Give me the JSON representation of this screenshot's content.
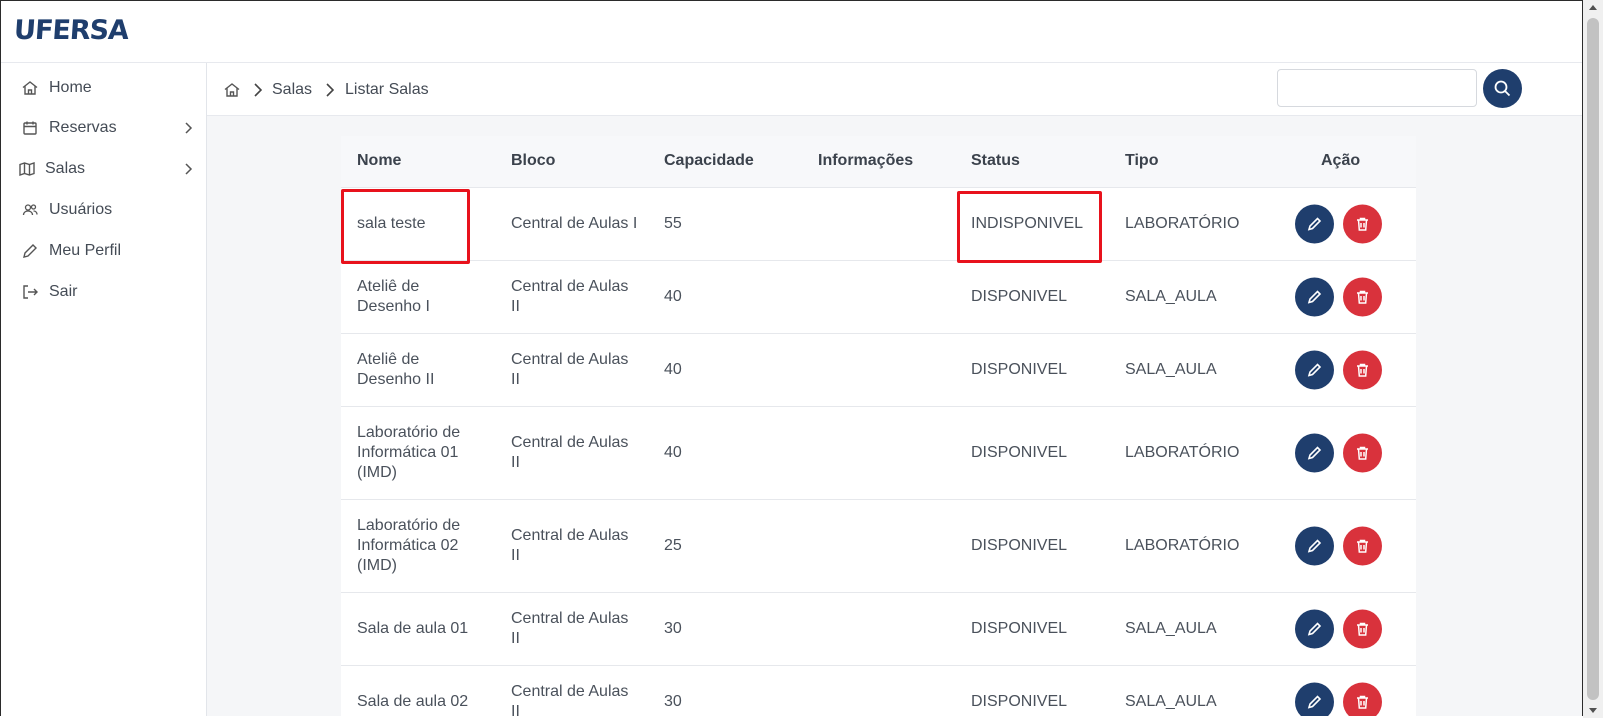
{
  "app": {
    "logo": "UFERSA"
  },
  "sidebar": {
    "items": [
      {
        "label": "Home",
        "icon": "home-icon",
        "has_submenu": false
      },
      {
        "label": "Reservas",
        "icon": "calendar-icon",
        "has_submenu": true
      },
      {
        "label": "Salas",
        "icon": "map-icon",
        "has_submenu": true
      },
      {
        "label": "Usuários",
        "icon": "users-icon",
        "has_submenu": false
      },
      {
        "label": "Meu Perfil",
        "icon": "pencil-icon",
        "has_submenu": false
      },
      {
        "label": "Sair",
        "icon": "logout-icon",
        "has_submenu": false
      }
    ]
  },
  "breadcrumb": {
    "icon": "home-icon",
    "items": [
      "Salas",
      "Listar Salas"
    ]
  },
  "search": {
    "value": "",
    "placeholder": "",
    "button_icon": "search-icon"
  },
  "table": {
    "columns": [
      "Nome",
      "Bloco",
      "Capacidade",
      "Informações",
      "Status",
      "Tipo",
      "Ação"
    ],
    "rows": [
      {
        "nome": "sala teste",
        "bloco": "Central de Aulas I",
        "capacidade": "55",
        "informacoes": "",
        "status": "INDISPONIVEL",
        "tipo": "LABORATÓRIO"
      },
      {
        "nome": "Ateliê de Desenho I",
        "bloco": "Central de Aulas II",
        "capacidade": "40",
        "informacoes": "",
        "status": "DISPONIVEL",
        "tipo": "SALA_AULA"
      },
      {
        "nome": "Ateliê de Desenho II",
        "bloco": "Central de Aulas II",
        "capacidade": "40",
        "informacoes": "",
        "status": "DISPONIVEL",
        "tipo": "SALA_AULA"
      },
      {
        "nome": "Laboratório de Informática 01 (IMD)",
        "bloco": "Central de Aulas II",
        "capacidade": "40",
        "informacoes": "",
        "status": "DISPONIVEL",
        "tipo": "LABORATÓRIO"
      },
      {
        "nome": "Laboratório de Informática 02 (IMD)",
        "bloco": "Central de Aulas II",
        "capacidade": "25",
        "informacoes": "",
        "status": "DISPONIVEL",
        "tipo": "LABORATÓRIO"
      },
      {
        "nome": "Sala de aula 01",
        "bloco": "Central de Aulas II",
        "capacidade": "30",
        "informacoes": "",
        "status": "DISPONIVEL",
        "tipo": "SALA_AULA"
      },
      {
        "nome": "Sala de aula 02",
        "bloco": "Central de Aulas II",
        "capacidade": "30",
        "informacoes": "",
        "status": "DISPONIVEL",
        "tipo": "SALA_AULA"
      }
    ],
    "actions": {
      "edit_icon": "pencil-icon",
      "delete_icon": "trash-icon"
    }
  },
  "colors": {
    "brand": "#1f3e6d",
    "edit_button": "#1f3e6d",
    "delete_button": "#d9323c",
    "highlight_box": "#e8121c"
  }
}
